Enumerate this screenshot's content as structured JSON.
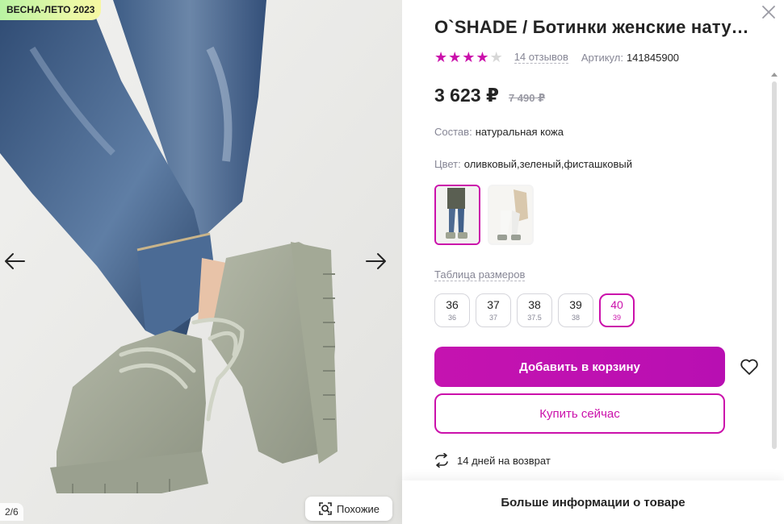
{
  "gallery": {
    "season_badge": "ВЕСНА-ЛЕТО 2023",
    "counter": "2/6",
    "similar_label": "Похожие",
    "prev_icon": "arrow-left-icon",
    "next_icon": "arrow-right-icon"
  },
  "product": {
    "title": "O`SHADE / Ботинки женские натуральная кожа",
    "rating": 4,
    "rating_max": 5,
    "reviews": "14 отзывов",
    "sku_label": "Артикул:",
    "sku": "141845900",
    "price": "3 623 ₽",
    "old_price": "7 490 ₽",
    "composition_label": "Состав:",
    "composition": "натуральная кожа",
    "color_label": "Цвет:",
    "color": "оливковый,зеленый,фисташковый",
    "size_table_label": "Таблица размеров",
    "sizes": [
      {
        "ru": "36",
        "eu": "36",
        "selected": false
      },
      {
        "ru": "37",
        "eu": "37",
        "selected": false
      },
      {
        "ru": "38",
        "eu": "37.5",
        "selected": false
      },
      {
        "ru": "39",
        "eu": "38",
        "selected": false
      },
      {
        "ru": "40",
        "eu": "39",
        "selected": true
      }
    ],
    "add_to_cart": "Добавить в корзину",
    "buy_now": "Купить сейчас",
    "return_text": "14 дней на возврат",
    "more_info": "Больше информации о товаре"
  },
  "colors": {
    "accent": "#cb11ab",
    "text": "#242424",
    "muted": "#868695"
  }
}
